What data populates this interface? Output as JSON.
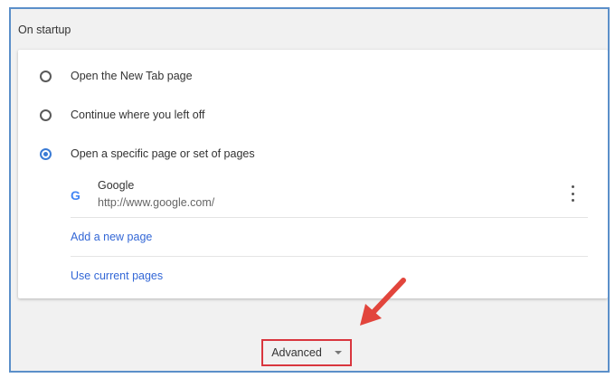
{
  "section": {
    "title": "On startup"
  },
  "startup_options": [
    {
      "label": "Open the New Tab page",
      "checked": false
    },
    {
      "label": "Continue where you left off",
      "checked": false
    },
    {
      "label": "Open a specific page or set of pages",
      "checked": true
    }
  ],
  "pages": [
    {
      "icon": "google-favicon",
      "icon_glyph": "G",
      "name": "Google",
      "url": "http://www.google.com/"
    }
  ],
  "actions": {
    "add_page": "Add a new page",
    "use_current": "Use current pages"
  },
  "advanced": {
    "label": "Advanced",
    "icon": "chevron-down-icon"
  },
  "colors": {
    "accent": "#3a7bd5",
    "link": "#3367d6",
    "highlight_border": "#d9363e",
    "annotation_arrow": "#e2453c",
    "frame_border": "#5b8fc9"
  }
}
